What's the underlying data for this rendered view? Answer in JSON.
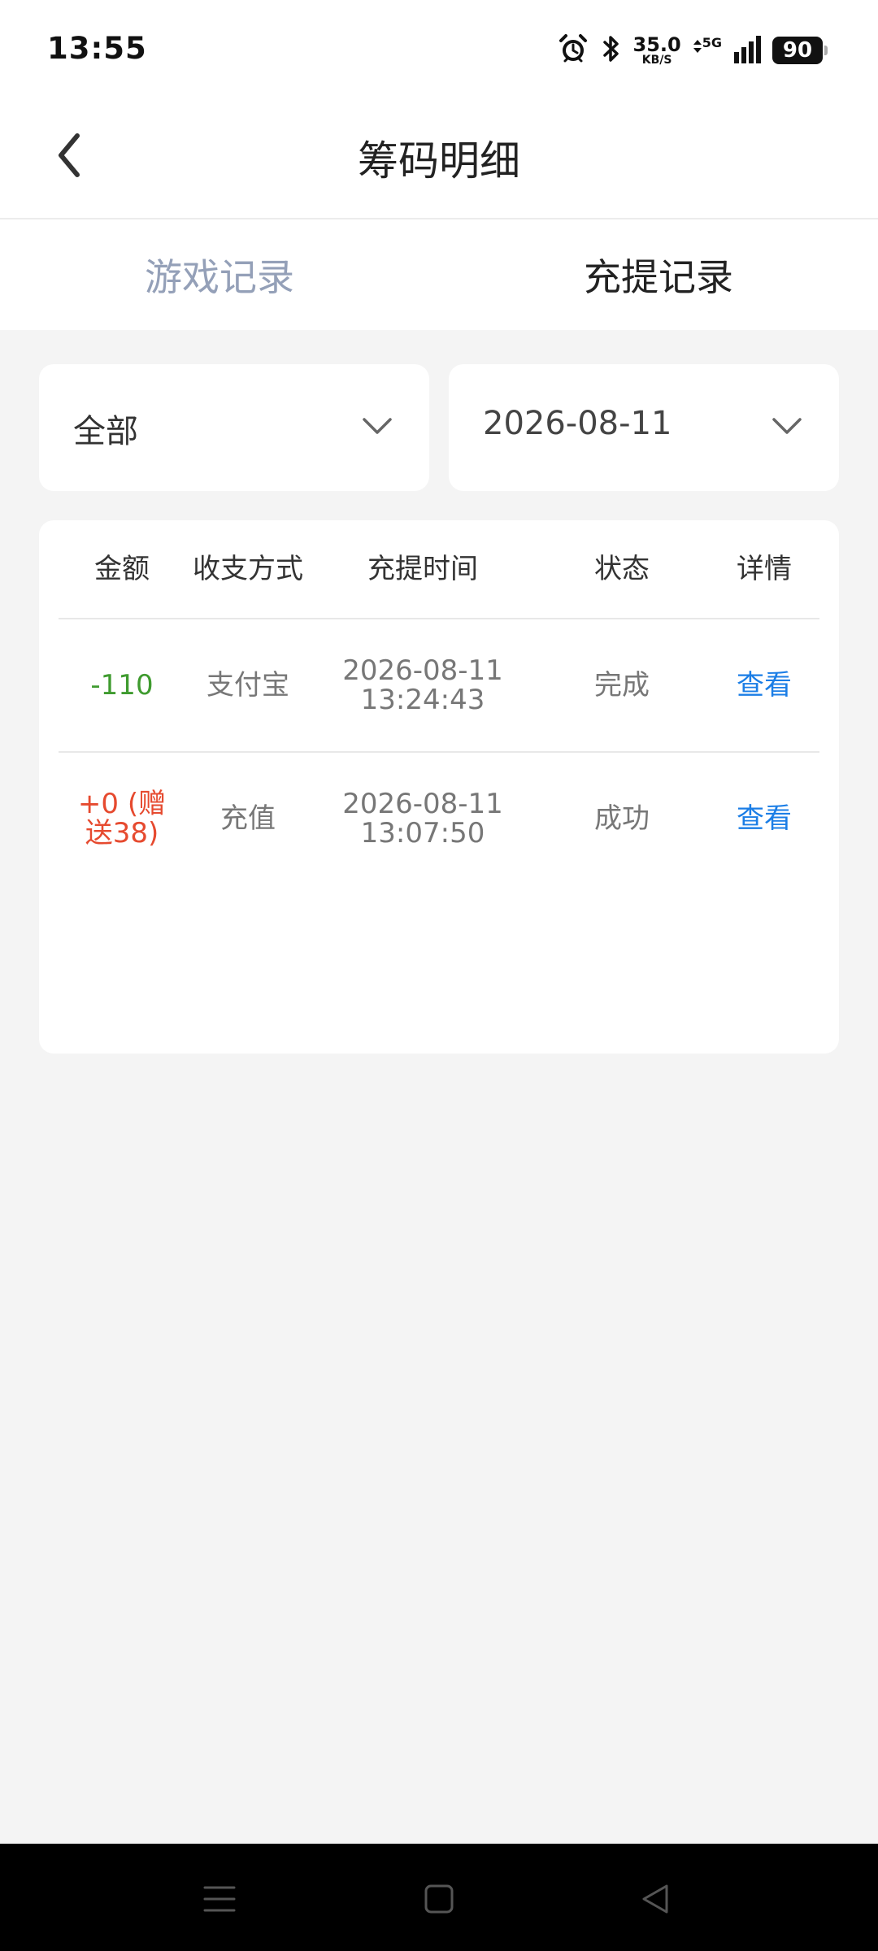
{
  "status_bar": {
    "time": "13:55",
    "speed_value": "35.0",
    "speed_unit": "KB/S",
    "network": "5G",
    "battery": "90",
    "icons": [
      "alarm-icon",
      "bluetooth-icon",
      "data-arrows-icon",
      "signal-icon",
      "battery-icon"
    ]
  },
  "header": {
    "title": "筹码明细",
    "back_icon": "chevron-left-icon"
  },
  "tabs": [
    {
      "label": "游戏记录",
      "active": false
    },
    {
      "label": "充提记录",
      "active": true
    }
  ],
  "filters": {
    "type": {
      "value": "全部",
      "icon": "chevron-down-icon"
    },
    "date": {
      "value": "2026-08-11",
      "icon": "chevron-down-icon"
    }
  },
  "table": {
    "headers": [
      "金额",
      "收支方式",
      "充提时间",
      "状态",
      "详情"
    ],
    "rows": [
      {
        "amount_line1": "-110",
        "amount_line2": "",
        "method": "支付宝",
        "time_date": "2026-08-11",
        "time_clock": "13:24:43",
        "status": "完成",
        "detail": "查看"
      },
      {
        "amount_line1": "+0 (赠",
        "amount_line2": "送38)",
        "method": "充值",
        "time_date": "2026-08-11",
        "time_clock": "13:07:50",
        "status": "成功",
        "detail": "查看"
      }
    ]
  },
  "colors": {
    "negative_amount": "#3f9b2f",
    "positive_amount": "#e64a2f",
    "link": "#1b7ee6",
    "inactive_tab": "#94a0b8"
  },
  "nav_bar": {
    "icons": [
      "menu-icon",
      "home-square-icon",
      "back-triangle-icon"
    ]
  }
}
